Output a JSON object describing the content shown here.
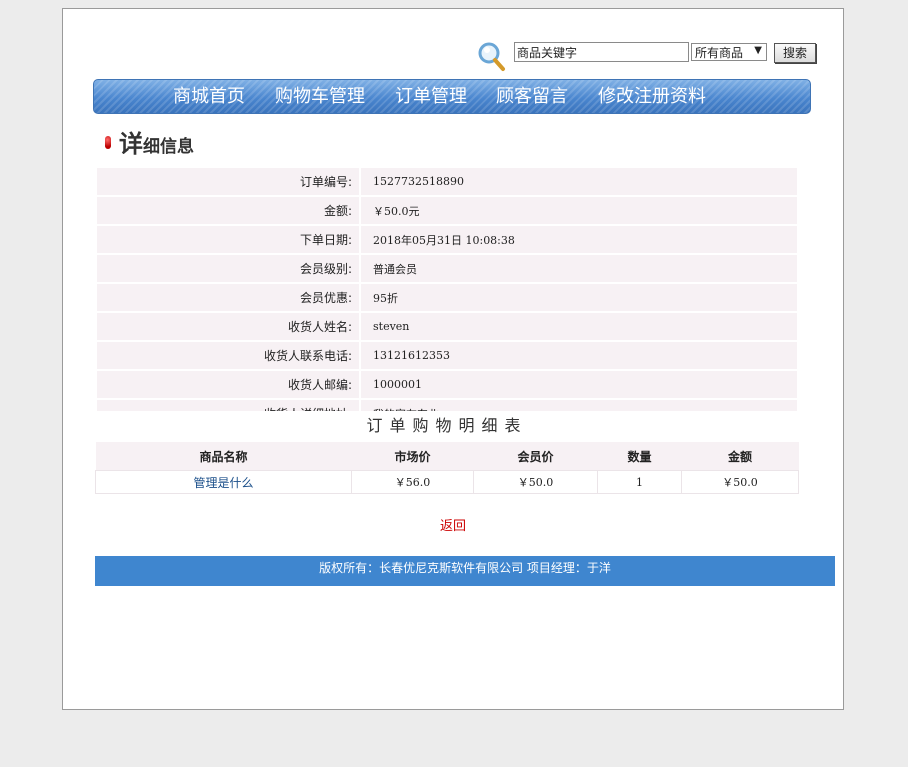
{
  "search": {
    "value": "商品关键字",
    "category_selected": "所有商品",
    "button_label": "搜索"
  },
  "nav": {
    "items": [
      "商城首页",
      "购物车管理",
      "订单管理",
      "顾客留言",
      "修改注册资料"
    ]
  },
  "heading": {
    "big": "详",
    "rest": "细信息"
  },
  "details": [
    {
      "label": "订单编号:",
      "value": "1527732518890"
    },
    {
      "label": "金额:",
      "value": "￥50.0元"
    },
    {
      "label": "下单日期:",
      "value": "2018年05月31日 10:08:38"
    },
    {
      "label": "会员级别:",
      "value": "普通会员"
    },
    {
      "label": "会员优惠:",
      "value": "95折"
    },
    {
      "label": "收货人姓名:",
      "value": "steven"
    },
    {
      "label": "收货人联系电话:",
      "value": "13121612353"
    },
    {
      "label": "收货人邮编:",
      "value": "1000001"
    },
    {
      "label": "收货人详细地址:",
      "value": "我的家在东北"
    }
  ],
  "items_table": {
    "title": "订单购物明细表",
    "headers": [
      "商品名称",
      "市场价",
      "会员价",
      "数量",
      "金额"
    ],
    "rows": [
      [
        "管理是什么",
        "￥56.0",
        "￥50.0",
        "1",
        "￥50.0"
      ]
    ]
  },
  "back_label": "返回",
  "footer": "版权所有：长春优尼克斯软件有限公司 项目经理：于洋",
  "colors": {
    "nav_blue": "#4a86cf",
    "footer_blue": "#3f86cf",
    "link_red": "#cc0000",
    "row_bg": "#f7f1f4"
  }
}
